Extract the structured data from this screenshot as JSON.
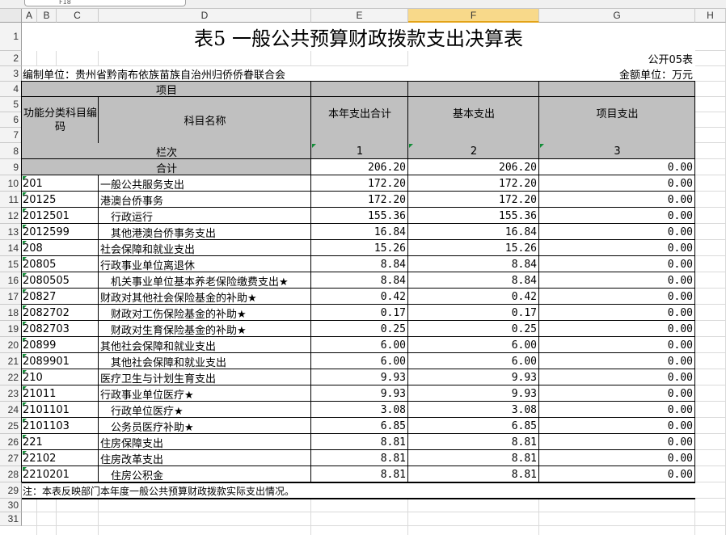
{
  "app": {
    "tab_stub": "F18"
  },
  "columns": [
    "A",
    "B",
    "C",
    "D",
    "E",
    "F",
    "G",
    "H"
  ],
  "selected_column": "F",
  "rows": [
    "1",
    "2",
    "3",
    "4",
    "5",
    "6",
    "7",
    "8",
    "9",
    "10",
    "11",
    "12",
    "13",
    "14",
    "15",
    "16",
    "17",
    "18",
    "19",
    "20",
    "21",
    "22",
    "23",
    "24",
    "25",
    "26",
    "27",
    "28",
    "29",
    "30",
    "31"
  ],
  "sheet": {
    "title": "表5  一般公共预算财政拨款支出决算表",
    "code": "公开05表",
    "unit_left": "编制单位：贵州省黔南布依族苗族自治州归侨侨眷联合会",
    "unit_right": "金额单位：万元",
    "headers": {
      "item": "项目",
      "func_code": "功能分类科目编码",
      "subject_name": "科目名称",
      "total": "本年支出合计",
      "basic": "基本支出",
      "project": "项目支出",
      "lanci": "栏次",
      "col1": "1",
      "col2": "2",
      "col3": "3",
      "sum_label": "合计"
    },
    "totals": {
      "total": "206.20",
      "basic": "206.20",
      "project": "0.00"
    },
    "data_rows": [
      {
        "code": "201",
        "name": "一般公共服务支出",
        "total": "172.20",
        "basic": "172.20",
        "project": "0.00"
      },
      {
        "code": "20125",
        "name": "港澳台侨事务",
        "total": "172.20",
        "basic": "172.20",
        "project": "0.00"
      },
      {
        "code": "2012501",
        "name": "　行政运行",
        "total": "155.36",
        "basic": "155.36",
        "project": "0.00"
      },
      {
        "code": "2012599",
        "name": "　其他港澳台侨事务支出",
        "total": "16.84",
        "basic": "16.84",
        "project": "0.00"
      },
      {
        "code": "208",
        "name": "社会保障和就业支出",
        "total": "15.26",
        "basic": "15.26",
        "project": "0.00"
      },
      {
        "code": "20805",
        "name": "行政事业单位离退休",
        "total": "8.84",
        "basic": "8.84",
        "project": "0.00"
      },
      {
        "code": "2080505",
        "name": "　机关事业单位基本养老保险缴费支出★",
        "total": "8.84",
        "basic": "8.84",
        "project": "0.00"
      },
      {
        "code": "20827",
        "name": "财政对其他社会保险基金的补助★",
        "total": "0.42",
        "basic": "0.42",
        "project": "0.00"
      },
      {
        "code": "2082702",
        "name": "　财政对工伤保险基金的补助★",
        "total": "0.17",
        "basic": "0.17",
        "project": "0.00"
      },
      {
        "code": "2082703",
        "name": "　财政对生育保险基金的补助★",
        "total": "0.25",
        "basic": "0.25",
        "project": "0.00"
      },
      {
        "code": "20899",
        "name": "其他社会保障和就业支出",
        "total": "6.00",
        "basic": "6.00",
        "project": "0.00"
      },
      {
        "code": "2089901",
        "name": "　其他社会保障和就业支出",
        "total": "6.00",
        "basic": "6.00",
        "project": "0.00"
      },
      {
        "code": "210",
        "name": "医疗卫生与计划生育支出",
        "total": "9.93",
        "basic": "9.93",
        "project": "0.00"
      },
      {
        "code": "21011",
        "name": "行政事业单位医疗★",
        "total": "9.93",
        "basic": "9.93",
        "project": "0.00"
      },
      {
        "code": "2101101",
        "name": "　行政单位医疗★",
        "total": "3.08",
        "basic": "3.08",
        "project": "0.00"
      },
      {
        "code": "2101103",
        "name": "　公务员医疗补助★",
        "total": "6.85",
        "basic": "6.85",
        "project": "0.00"
      },
      {
        "code": "221",
        "name": "住房保障支出",
        "total": "8.81",
        "basic": "8.81",
        "project": "0.00"
      },
      {
        "code": "22102",
        "name": "住房改革支出",
        "total": "8.81",
        "basic": "8.81",
        "project": "0.00"
      },
      {
        "code": "2210201",
        "name": "　住房公积金",
        "total": "8.81",
        "basic": "8.81",
        "project": "0.00"
      }
    ],
    "note": "注：本表反映部门本年度一般公共预算财政拨款实际支出情况。"
  }
}
